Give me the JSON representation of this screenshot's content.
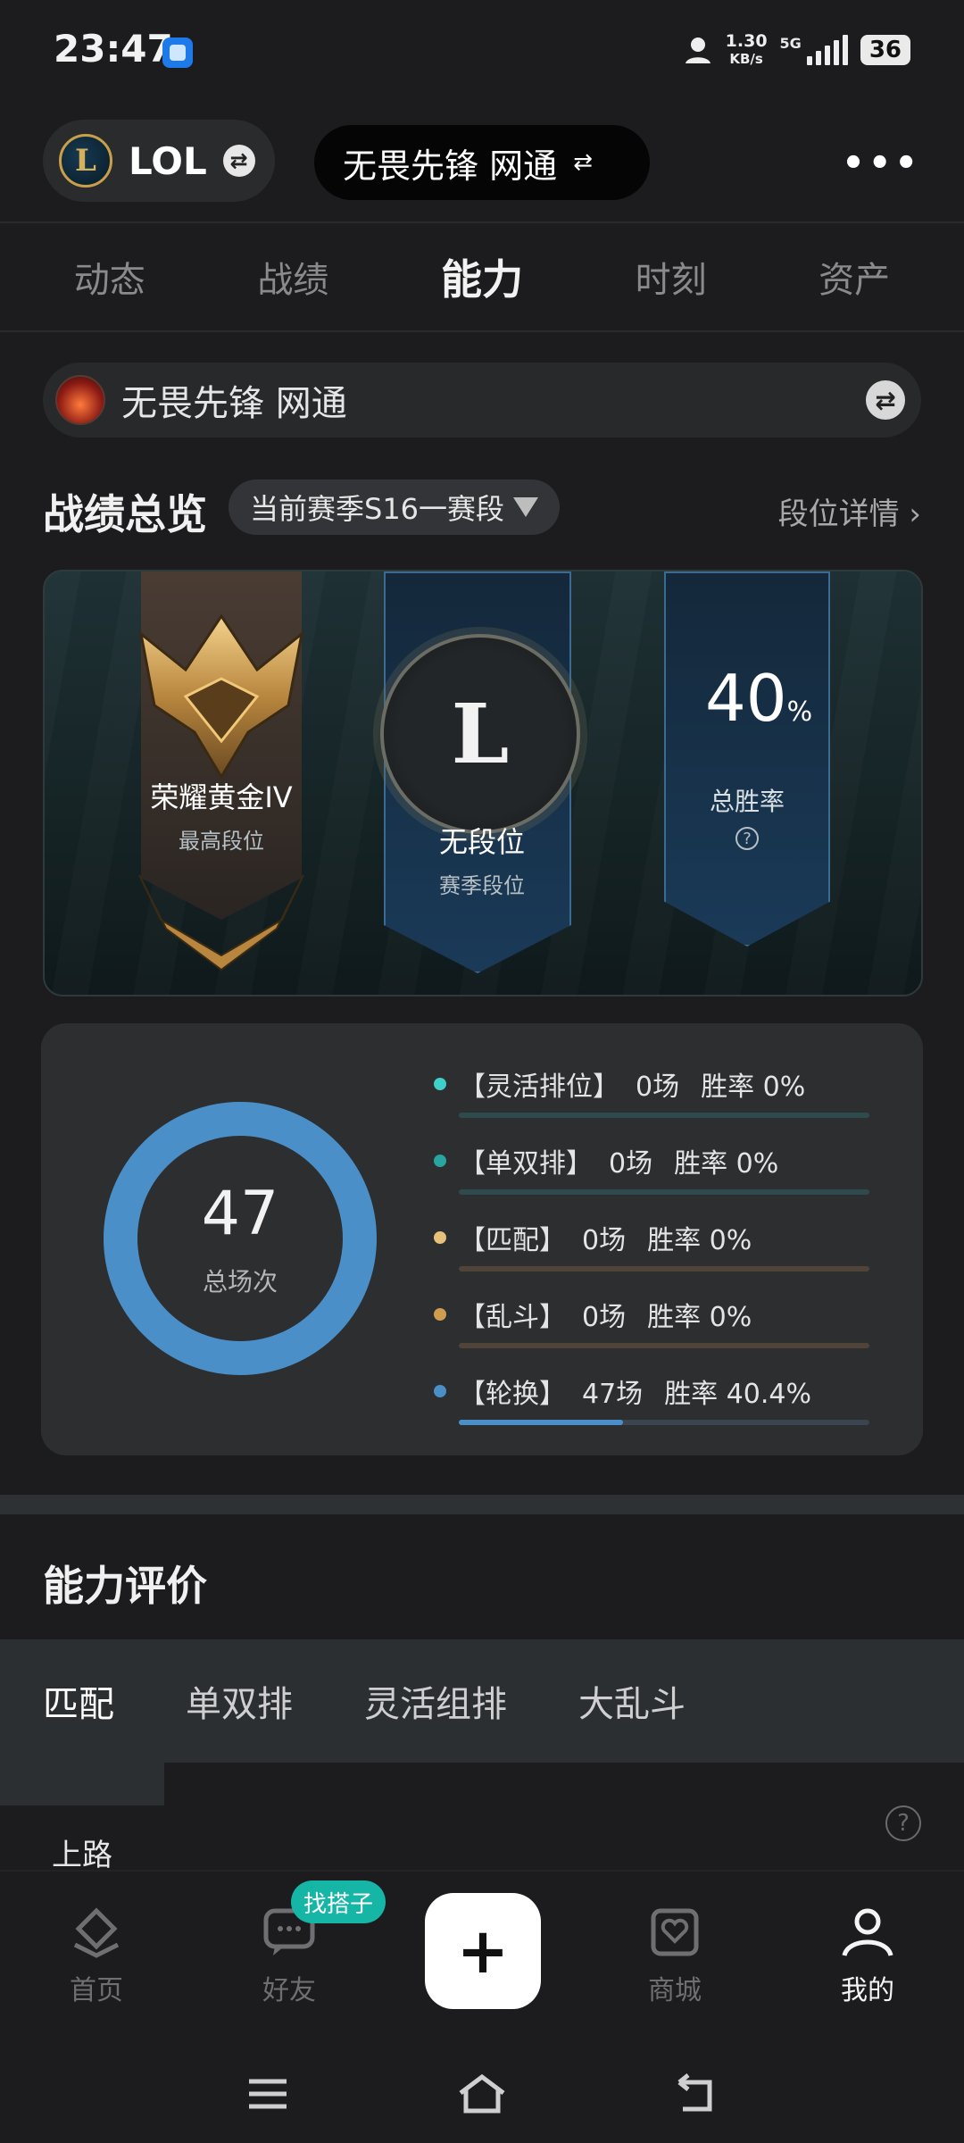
{
  "status_bar": {
    "time": "23:47",
    "net_speed": "1.30",
    "net_unit": "KB/s",
    "net_type": "5G",
    "battery": "36"
  },
  "top_bar": {
    "game_logo_letter": "L",
    "game_name": "LOL",
    "server_name": "无畏先锋 网通",
    "more_label": "•••"
  },
  "tabs": [
    {
      "label": "动态",
      "active": false
    },
    {
      "label": "战绩",
      "active": false
    },
    {
      "label": "能力",
      "active": true
    },
    {
      "label": "时刻",
      "active": false
    },
    {
      "label": "资产",
      "active": false
    }
  ],
  "account": {
    "name": "无畏先锋 网通"
  },
  "overview": {
    "title": "战绩总览",
    "season": "当前赛季S16一赛段",
    "rank_detail": "段位详情"
  },
  "rank_card": {
    "highest_rank": "荣耀黄金IV",
    "highest_rank_label": "最高段位",
    "season_emblem_letter": "L",
    "season_rank": "无段位",
    "season_rank_label": "赛季段位",
    "win_rate_value": "40",
    "win_rate_unit": "%",
    "win_rate_label": "总胜率"
  },
  "stats": {
    "total_games": "47",
    "total_games_label": "总场次",
    "modes": [
      {
        "name": "【灵活排位】",
        "games": "0场",
        "rate": "胜率 0%",
        "fraction": 0.0,
        "color": "#3fd0c9",
        "track": "#2f4a4d"
      },
      {
        "name": "【单双排】",
        "games": "0场",
        "rate": "胜率 0%",
        "fraction": 0.0,
        "color": "#27a59e",
        "track": "#2f4a4d"
      },
      {
        "name": "【匹配】",
        "games": "0场",
        "rate": "胜率 0%",
        "fraction": 0.0,
        "color": "#e7c07a",
        "track": "#4e4538"
      },
      {
        "name": "【乱斗】",
        "games": "0场",
        "rate": "胜率 0%",
        "fraction": 0.0,
        "color": "#cf9d50",
        "track": "#4e4538"
      },
      {
        "name": "【轮换】",
        "games": "47场",
        "rate": "胜率 40.4%",
        "fraction": 1.0,
        "color": "#4a8fc7",
        "track": "#3b4550",
        "bar_fill_percent": 40
      }
    ]
  },
  "ability": {
    "title": "能力评价",
    "tabs": [
      {
        "label": "匹配",
        "active": true
      },
      {
        "label": "单双排",
        "active": false
      },
      {
        "label": "灵活组排",
        "active": false
      },
      {
        "label": "大乱斗",
        "active": false
      }
    ],
    "lane": "上路"
  },
  "bottom_nav": {
    "items": [
      {
        "label": "首页",
        "icon": "home-icon",
        "active": false
      },
      {
        "label": "好友",
        "icon": "chat-icon",
        "active": false
      },
      {
        "label": "商城",
        "icon": "shop-icon",
        "active": false
      },
      {
        "label": "我的",
        "icon": "profile-icon",
        "active": true
      }
    ],
    "badge": "找搭子",
    "plus_label": "+"
  }
}
